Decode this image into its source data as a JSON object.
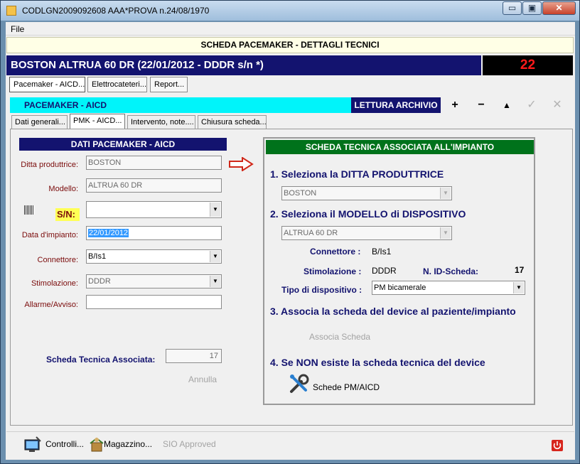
{
  "window": {
    "title": "CODLGN2009092608 AAA*PROVA n.24/08/1970",
    "controls": {
      "minimize": "▭",
      "maximize": "▣",
      "close": "✕"
    }
  },
  "menu": {
    "file": "File"
  },
  "header": {
    "title": "SCHEDA PACEMAKER - DETTAGLI TECNICI"
  },
  "banner": {
    "device_text": "BOSTON ALTRUA 60 DR (22/01/2012 - DDDR s/n *)",
    "counter": "22"
  },
  "buttons": {
    "pacemaker": "Pacemaker - AICD...",
    "elettrocateteri": "Elettrocateteri...",
    "report": "Report..."
  },
  "section_bar": {
    "title": "PACEMAKER - AICD",
    "archive_label": "LETTURA ARCHIVIO",
    "nav": {
      "add": "+",
      "remove": "−",
      "up": "▲",
      "check": "✓",
      "cancel": "✕"
    }
  },
  "tabs": [
    {
      "label": "Dati generali..."
    },
    {
      "label": "PMK - AICD..."
    },
    {
      "label": "Intervento, note...."
    },
    {
      "label": "Chiusura scheda..."
    }
  ],
  "left_panel": {
    "title": "DATI PACEMAKER - AICD",
    "ditta_label": "Ditta produttrice:",
    "ditta_value": "BOSTON",
    "modello_label": "Modello:",
    "modello_value": "ALTRUA 60 DR",
    "sn_label": "S/N:",
    "sn_value": "",
    "data_label": "Data d'impianto:",
    "data_value": "22/01/2012",
    "connettore_label": "Connettore:",
    "connettore_value": "B/Is1",
    "stimolazione_label": "Stimolazione:",
    "stimolazione_value": "DDDR",
    "allarme_label": "Allarme/Avviso:",
    "allarme_value": "",
    "scheda_label": "Scheda Tecnica Associata:",
    "scheda_value": "17",
    "annulla": "Annulla"
  },
  "right_panel": {
    "title": "SCHEDA TECNICA ASSOCIATA ALL'IMPIANTO",
    "step1": "1. Seleziona la DITTA PRODUTTRICE",
    "ditta_select": "BOSTON",
    "step2": "2. Seleziona il MODELLO di DISPOSITIVO",
    "modello_select": "ALTRUA 60 DR",
    "connettore_key": "Connettore :",
    "connettore_val": "B/Is1",
    "stimolazione_key": "Stimolazione :",
    "stimolazione_val": "DDDR",
    "id_key": "N. ID-Scheda:",
    "id_val": "17",
    "tipo_key": "Tipo di dispositivo :",
    "tipo_val": "PM bicamerale",
    "step3": "3. Associa la scheda del device al paziente/impianto",
    "associa": "Associa Scheda",
    "step4": "4. Se NON esiste la scheda tecnica del device",
    "schede_btn": "Schede PM/AICD"
  },
  "bottom": {
    "controlli": "Controlli...",
    "magazzino": "Magazzino...",
    "sio": "SIO Approved"
  },
  "colors": {
    "navy": "#13136f",
    "cyan": "#00f4fa",
    "green": "#00721b",
    "counter_red": "#ff1a1a",
    "label_red": "#7a0a0a"
  }
}
